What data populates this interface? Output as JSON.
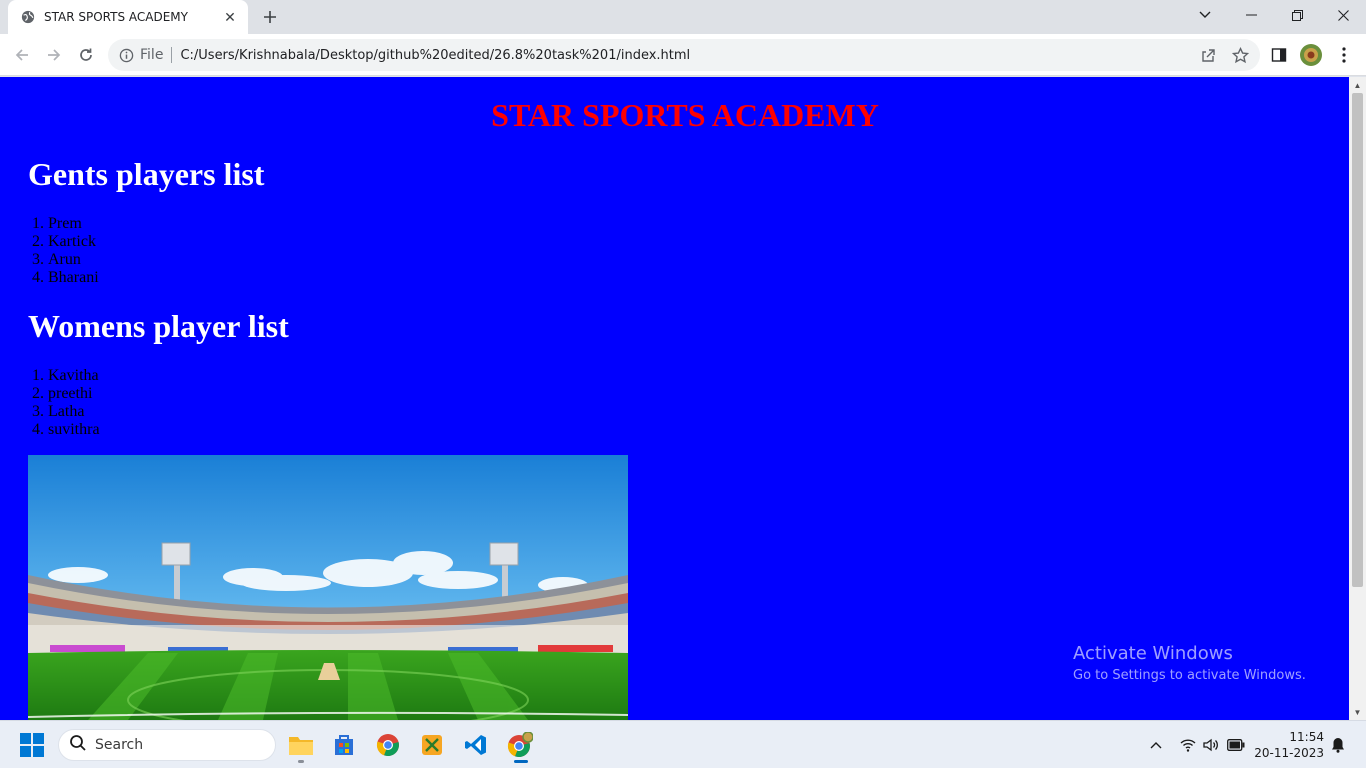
{
  "browser": {
    "tab_title": "STAR SPORTS ACADEMY",
    "url_scheme_label": "File",
    "url": "C:/Users/Krishnabala/Desktop/github%20edited/26.8%20task%201/index.html"
  },
  "page": {
    "heading": "STAR SPORTS ACADEMY",
    "heading_color": "#ff0000",
    "background_color": "#0000ff",
    "gents": {
      "title": "Gents players list",
      "players": [
        {
          "num": "1.",
          "name": "Prem"
        },
        {
          "num": "2.",
          "name": "Kartick"
        },
        {
          "num": "3.",
          "name": "Arun"
        },
        {
          "num": "4.",
          "name": "Bharani"
        }
      ]
    },
    "womens": {
      "title": "Womens player list",
      "players": [
        {
          "num": "1.",
          "name": "Kavitha"
        },
        {
          "num": "2.",
          "name": "preethi"
        },
        {
          "num": "3.",
          "name": "Latha"
        },
        {
          "num": "4.",
          "name": "suvithra"
        }
      ]
    },
    "watermark": {
      "line1": "Activate Windows",
      "line2": "Go to Settings to activate Windows."
    }
  },
  "taskbar": {
    "search_placeholder": "Search",
    "time": "11:54",
    "date": "20-11-2023"
  }
}
